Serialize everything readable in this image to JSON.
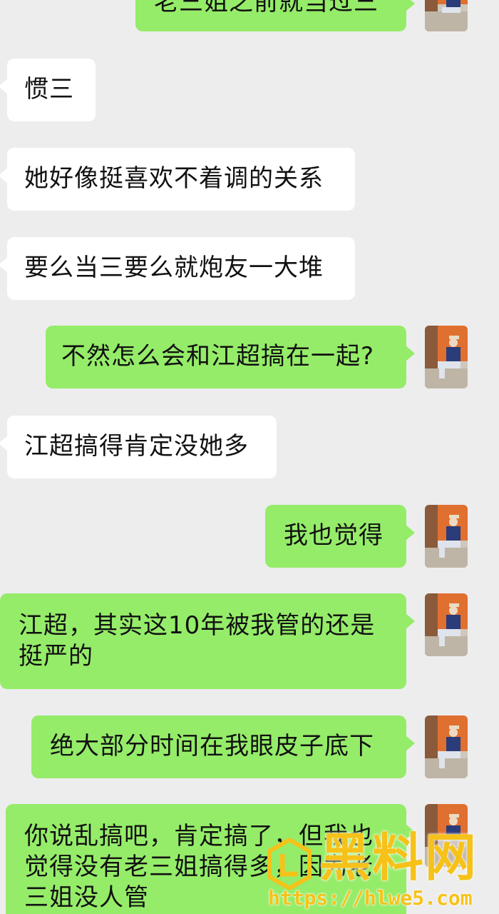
{
  "messages": [
    {
      "direction": "outgoing",
      "text": "老三姐之前就当过三"
    },
    {
      "direction": "incoming",
      "text": "惯三"
    },
    {
      "direction": "incoming",
      "text": "她好像挺喜欢不着调的关系"
    },
    {
      "direction": "incoming",
      "text": "要么当三要么就炮友一大堆"
    },
    {
      "direction": "outgoing",
      "text": "不然怎么会和江超搞在一起?"
    },
    {
      "direction": "incoming",
      "text": "江超搞得肯定没她多"
    },
    {
      "direction": "outgoing",
      "text": "我也觉得"
    },
    {
      "direction": "outgoing",
      "text": "江超，其实这10年被我管的还是挺严的"
    },
    {
      "direction": "outgoing",
      "text": "绝大部分时间在我眼皮子底下"
    },
    {
      "direction": "outgoing",
      "text": "你说乱搞吧，肯定搞了，但我也觉得没有老三姐搞得多，因为老三姐没人管"
    }
  ],
  "watermark": {
    "brand": "黑料网",
    "url": "https://hlwe5.com"
  },
  "colors": {
    "background": "#ededed",
    "outgoing_bubble": "#95ec69",
    "incoming_bubble": "#ffffff",
    "watermark": "#f6c21a"
  }
}
